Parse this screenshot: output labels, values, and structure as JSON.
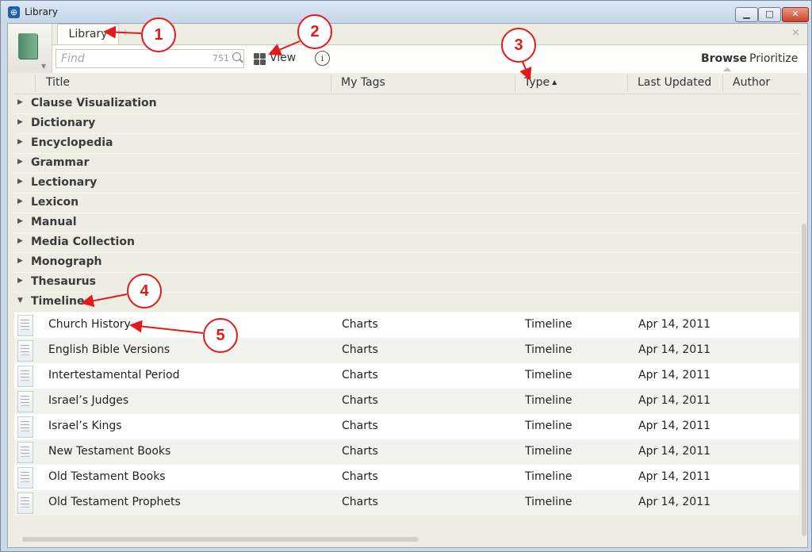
{
  "window": {
    "title": "Library",
    "app_icon": "logos-app-icon",
    "controls": {
      "minimize": "▁",
      "maximize": "□",
      "close": "✕"
    }
  },
  "tabs": {
    "active": "Library",
    "add": "+",
    "close_all": "×"
  },
  "toolbar": {
    "find_placeholder": "Find",
    "find_count": "751",
    "view_label": "View",
    "info": "i",
    "browse": "Browse",
    "prioritize": "Prioritize"
  },
  "columns": {
    "title": "Title",
    "tags": "My Tags",
    "type": "Type",
    "type_sort": "▲",
    "updated": "Last Updated",
    "author": "Author"
  },
  "groups": [
    {
      "label": "Clause Visualization",
      "expanded": false
    },
    {
      "label": "Dictionary",
      "expanded": false
    },
    {
      "label": "Encyclopedia",
      "expanded": false
    },
    {
      "label": "Grammar",
      "expanded": false
    },
    {
      "label": "Lectionary",
      "expanded": false
    },
    {
      "label": "Lexicon",
      "expanded": false
    },
    {
      "label": "Manual",
      "expanded": false
    },
    {
      "label": "Media Collection",
      "expanded": false
    },
    {
      "label": "Monograph",
      "expanded": false
    },
    {
      "label": "Thesaurus",
      "expanded": false
    },
    {
      "label": "Timeline",
      "expanded": true
    }
  ],
  "collapsed_marker": "▶",
  "expanded_marker": "▼",
  "items": [
    {
      "title": "Church History",
      "tags": "Charts",
      "type": "Timeline",
      "updated": "Apr 14, 2011"
    },
    {
      "title": "English Bible Versions",
      "tags": "Charts",
      "type": "Timeline",
      "updated": "Apr 14, 2011"
    },
    {
      "title": "Intertestamental Period",
      "tags": "Charts",
      "type": "Timeline",
      "updated": "Apr 14, 2011"
    },
    {
      "title": "Israel’s Judges",
      "tags": "Charts",
      "type": "Timeline",
      "updated": "Apr 14, 2011"
    },
    {
      "title": "Israel’s Kings",
      "tags": "Charts",
      "type": "Timeline",
      "updated": "Apr 14, 2011"
    },
    {
      "title": "New Testament Books",
      "tags": "Charts",
      "type": "Timeline",
      "updated": "Apr 14, 2011"
    },
    {
      "title": "Old Testament Books",
      "tags": "Charts",
      "type": "Timeline",
      "updated": "Apr 14, 2011"
    },
    {
      "title": "Old Testament Prophets",
      "tags": "Charts",
      "type": "Timeline",
      "updated": "Apr 14, 2011"
    }
  ],
  "callouts": [
    "1",
    "2",
    "3",
    "4",
    "5"
  ],
  "colors": {
    "callout": "#e01b1b",
    "titlebar": "#c5d6e8",
    "list_bg": "#eeede4"
  }
}
